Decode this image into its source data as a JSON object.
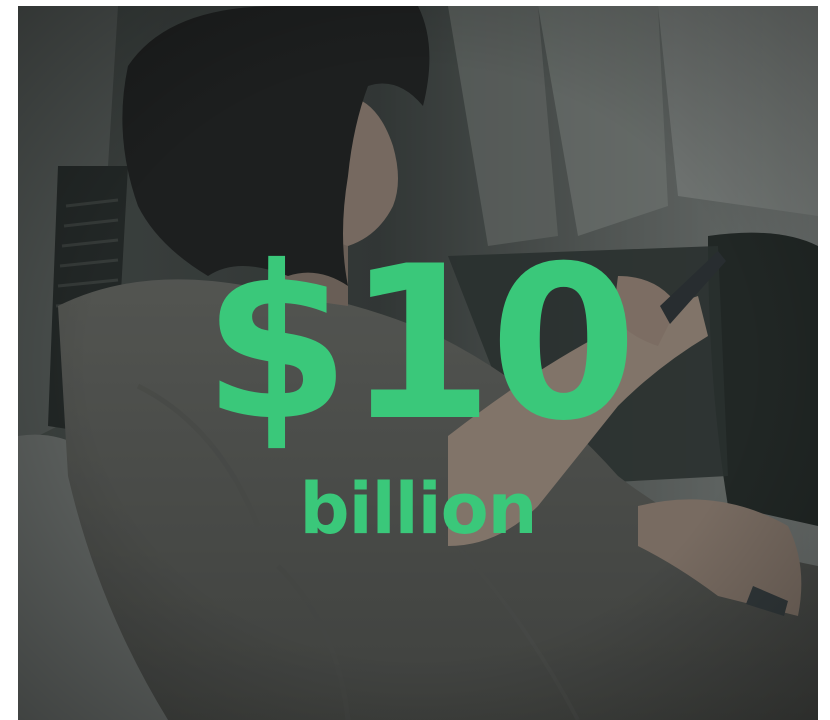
{
  "hero": {
    "amount": "$10",
    "unit": "billion"
  },
  "colors": {
    "accent_text": "#3ac87a",
    "overlay_tint": "#1e2624"
  },
  "image": {
    "subject": "person-with-phone-photo"
  }
}
